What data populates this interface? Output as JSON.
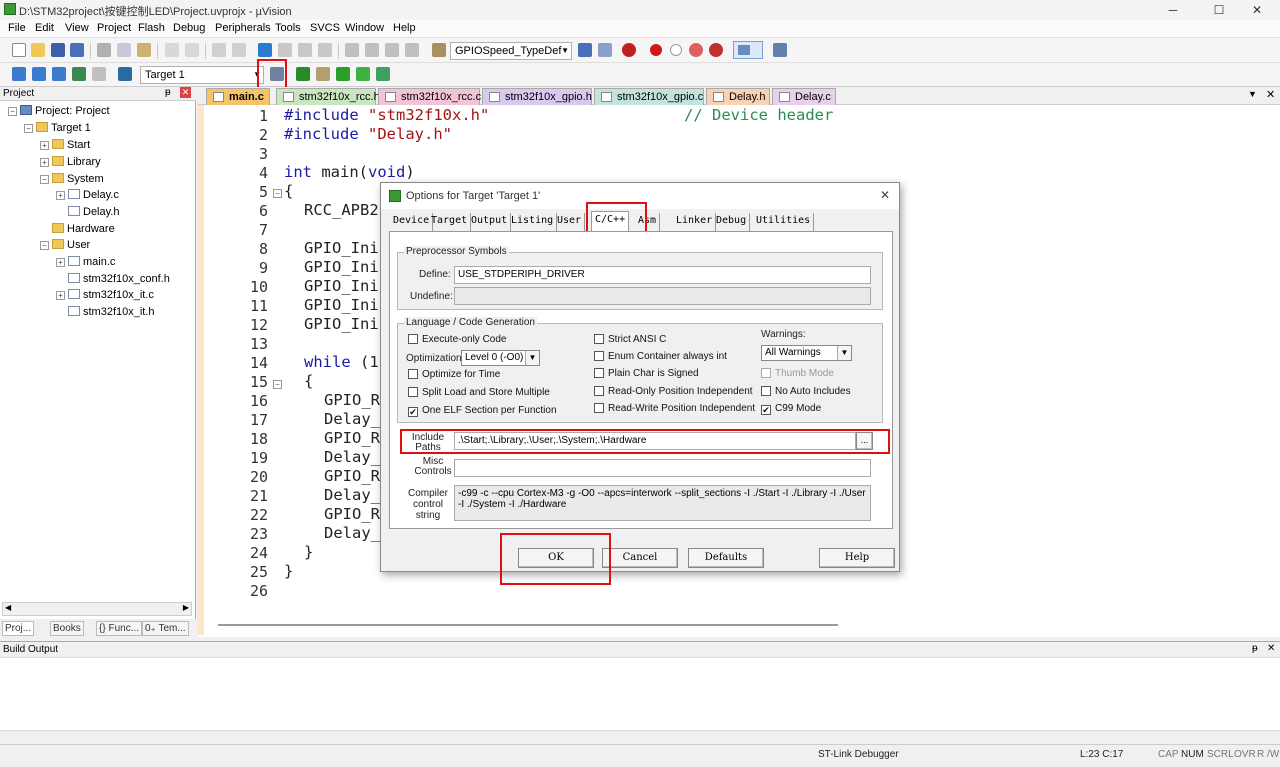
{
  "window": {
    "title": "D:\\STM32project\\按键控制LED\\Project.uvprojx - µVision",
    "minimize": "─",
    "maximize": "☐",
    "close": "✕"
  },
  "menu": [
    "File",
    "Edit",
    "View",
    "Project",
    "Flash",
    "Debug",
    "Peripherals",
    "Tools",
    "SVCS",
    "Window",
    "Help"
  ],
  "toolbar": {
    "function_combo": "GPIOSpeed_TypeDef",
    "target_combo": "Target 1"
  },
  "project_panel": {
    "title": "Project",
    "pin": "ᵽ",
    "close": "✕",
    "tree": {
      "root": "Project: Project",
      "target": "Target 1",
      "groups": [
        {
          "name": "Start"
        },
        {
          "name": "Library"
        },
        {
          "name": "System",
          "files": [
            "Delay.c",
            "Delay.h"
          ]
        },
        {
          "name": "Hardware"
        },
        {
          "name": "User",
          "files": [
            "main.c",
            "stm32f10x_conf.h",
            "stm32f10x_it.c",
            "stm32f10x_it.h"
          ]
        }
      ]
    },
    "bottom_tabs": [
      "Proj...",
      "Books",
      "{} Func...",
      "0₊ Tem..."
    ]
  },
  "editor": {
    "tabs": [
      {
        "label": "main.c",
        "color": "#f5c46a",
        "active": true
      },
      {
        "label": "stm32f10x_rcc.h",
        "color": "#c9e6c0"
      },
      {
        "label": "stm32f10x_rcc.c",
        "color": "#f3c3d8"
      },
      {
        "label": "stm32f10x_gpio.h",
        "color": "#d7c9f0"
      },
      {
        "label": "stm32f10x_gpio.c",
        "color": "#c3e4de"
      },
      {
        "label": "Delay.h",
        "color": "#f7d2b4"
      },
      {
        "label": "Delay.c",
        "color": "#e8d0ec"
      }
    ],
    "line_numbers": [
      "1",
      "2",
      "3",
      "4",
      "5",
      "6",
      "7",
      "8",
      "9",
      "10",
      "11",
      "12",
      "13",
      "14",
      "15",
      "16",
      "17",
      "18",
      "19",
      "20",
      "21",
      "22",
      "23",
      "24",
      "25",
      "26"
    ],
    "code": {
      "l1_directive": "#include",
      "l1_file": "\"stm32f10x.h\"",
      "l1_comment": "// Device header",
      "l2_directive": "#include",
      "l2_file": "\"Delay.h\"",
      "l4_type": "int",
      "l4_name": "main(",
      "l4_void": "void",
      "l4_close": ")",
      "l5": "{",
      "l6": "RCC_APB2",
      "l8": "GPIO_Ini",
      "l9": "GPIO_Ini",
      "l10": "GPIO_Ini",
      "l11": "GPIO_Ini",
      "l12": "GPIO_Ini",
      "l14_kw": "while",
      "l14_rest": " (1",
      "l15": "{",
      "l16": "GPIO_R",
      "l17": "Delay_",
      "l18": "GPIO_R",
      "l19": "Delay_",
      "l20": "GPIO_R",
      "l21": "Delay_",
      "l22": "GPIO_R",
      "l23": "Delay_",
      "l24": "}",
      "l25": "}"
    }
  },
  "build_output": {
    "title": "Build Output"
  },
  "statusbar": {
    "debugger": "ST-Link Debugger",
    "position": "L:23 C:17",
    "indicators": [
      "CAP",
      "NUM",
      "SCRL",
      "OVR",
      "R /W"
    ]
  },
  "dialog": {
    "title": "Options for Target 'Target 1'",
    "close": "✕",
    "tabs": [
      "Device",
      "Target",
      "Output",
      "Listing",
      "User",
      "C/C++",
      "Asm",
      "Linker",
      "Debug",
      "Utilities"
    ],
    "active_tab": "C/C++",
    "preprocessor": {
      "title": "Preprocessor Symbols",
      "define_label": "Define:",
      "define_value": "USE_STDPERIPH_DRIVER",
      "undefine_label": "Undefine:",
      "undefine_value": ""
    },
    "codegen": {
      "title": "Language / Code Generation",
      "execute_only": "Execute-only Code",
      "optimization_label": "Optimization:",
      "optimization_value": "Level 0 (-O0)",
      "optimize_time": "Optimize for Time",
      "split_load": "Split Load and Store Multiple",
      "one_elf": "One ELF Section per Function",
      "strict_ansi": "Strict ANSI C",
      "enum_container": "Enum Container always int",
      "plain_char": "Plain Char is Signed",
      "ro_pos": "Read-Only Position Independent",
      "rw_pos": "Read-Write Position Independent",
      "warnings_label": "Warnings:",
      "warnings_value": "All Warnings",
      "thumb_mode": "Thumb Mode",
      "no_auto_includes": "No Auto Includes",
      "c99_mode": "C99 Mode",
      "check": "✔"
    },
    "include_paths_label": "Include Paths",
    "include_paths_value": ".\\Start;.\\Library;.\\User;.\\System;.\\Hardware",
    "browse": "...",
    "misc_label": "Misc Controls",
    "misc_value": "",
    "compiler_label": "Compiler control string",
    "compiler_value": "-c99 -c --cpu Cortex-M3 -g -O0 --apcs=interwork --split_sections -I ./Start -I ./Library -I ./User -I ./System -I ./Hardware",
    "buttons": {
      "ok": "OK",
      "cancel": "Cancel",
      "defaults": "Defaults",
      "help": "Help"
    }
  }
}
